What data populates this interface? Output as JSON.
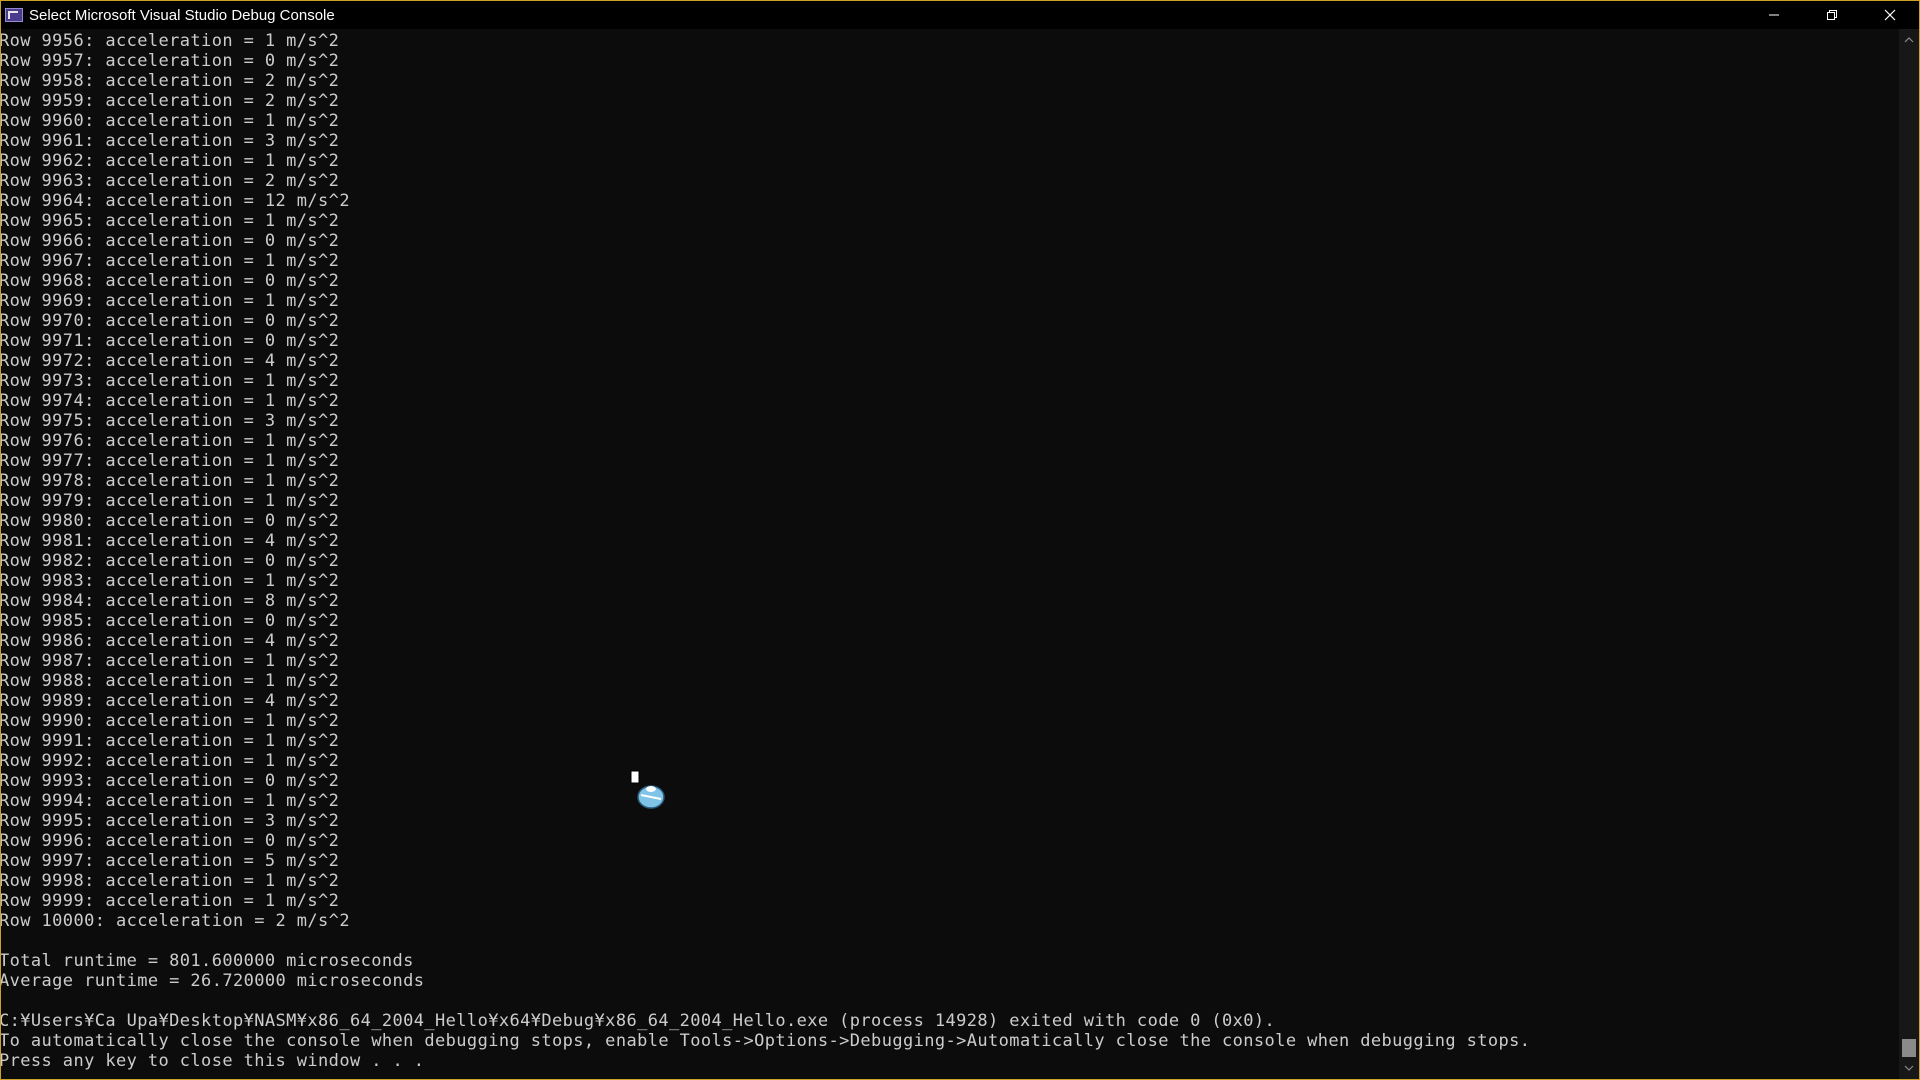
{
  "window": {
    "title": "Select Microsoft Visual Studio Debug Console",
    "icon": "console-app-icon",
    "controls": [
      "minimize-icon",
      "restore-icon",
      "close-icon"
    ]
  },
  "console": {
    "lines": [
      "Row 9956: acceleration = 1 m/s^2",
      "Row 9957: acceleration = 0 m/s^2",
      "Row 9958: acceleration = 2 m/s^2",
      "Row 9959: acceleration = 2 m/s^2",
      "Row 9960: acceleration = 1 m/s^2",
      "Row 9961: acceleration = 3 m/s^2",
      "Row 9962: acceleration = 1 m/s^2",
      "Row 9963: acceleration = 2 m/s^2",
      "Row 9964: acceleration = 12 m/s^2",
      "Row 9965: acceleration = 1 m/s^2",
      "Row 9966: acceleration = 0 m/s^2",
      "Row 9967: acceleration = 1 m/s^2",
      "Row 9968: acceleration = 0 m/s^2",
      "Row 9969: acceleration = 1 m/s^2",
      "Row 9970: acceleration = 0 m/s^2",
      "Row 9971: acceleration = 0 m/s^2",
      "Row 9972: acceleration = 4 m/s^2",
      "Row 9973: acceleration = 1 m/s^2",
      "Row 9974: acceleration = 1 m/s^2",
      "Row 9975: acceleration = 3 m/s^2",
      "Row 9976: acceleration = 1 m/s^2",
      "Row 9977: acceleration = 1 m/s^2",
      "Row 9978: acceleration = 1 m/s^2",
      "Row 9979: acceleration = 1 m/s^2",
      "Row 9980: acceleration = 0 m/s^2",
      "Row 9981: acceleration = 4 m/s^2",
      "Row 9982: acceleration = 0 m/s^2",
      "Row 9983: acceleration = 1 m/s^2",
      "Row 9984: acceleration = 8 m/s^2",
      "Row 9985: acceleration = 0 m/s^2",
      "Row 9986: acceleration = 4 m/s^2",
      "Row 9987: acceleration = 1 m/s^2",
      "Row 9988: acceleration = 1 m/s^2",
      "Row 9989: acceleration = 4 m/s^2",
      "Row 9990: acceleration = 1 m/s^2",
      "Row 9991: acceleration = 1 m/s^2",
      "Row 9992: acceleration = 1 m/s^2",
      "Row 9993: acceleration = 0 m/s^2",
      "Row 9994: acceleration = 1 m/s^2",
      "Row 9995: acceleration = 3 m/s^2",
      "Row 9996: acceleration = 0 m/s^2",
      "Row 9997: acceleration = 5 m/s^2",
      "Row 9998: acceleration = 1 m/s^2",
      "Row 9999: acceleration = 1 m/s^2",
      "Row 10000: acceleration = 2 m/s^2",
      "",
      "Total runtime = 801.600000 microseconds",
      "Average runtime = 26.720000 microseconds",
      "",
      "C:¥Users¥Ca Upa¥Desktop¥NASM¥x86_64_2004_Hello¥x64¥Debug¥x86_64_2004_Hello.exe (process 14928) exited with code 0 (0x0).",
      "To automatically close the console when debugging stops, enable Tools->Options->Debugging->Automatically close the console when debugging stops.",
      "Press any key to close this window . . ."
    ]
  },
  "colors": {
    "background": "#0c0c0c",
    "text": "#cccccc",
    "border": "#c9a227"
  }
}
